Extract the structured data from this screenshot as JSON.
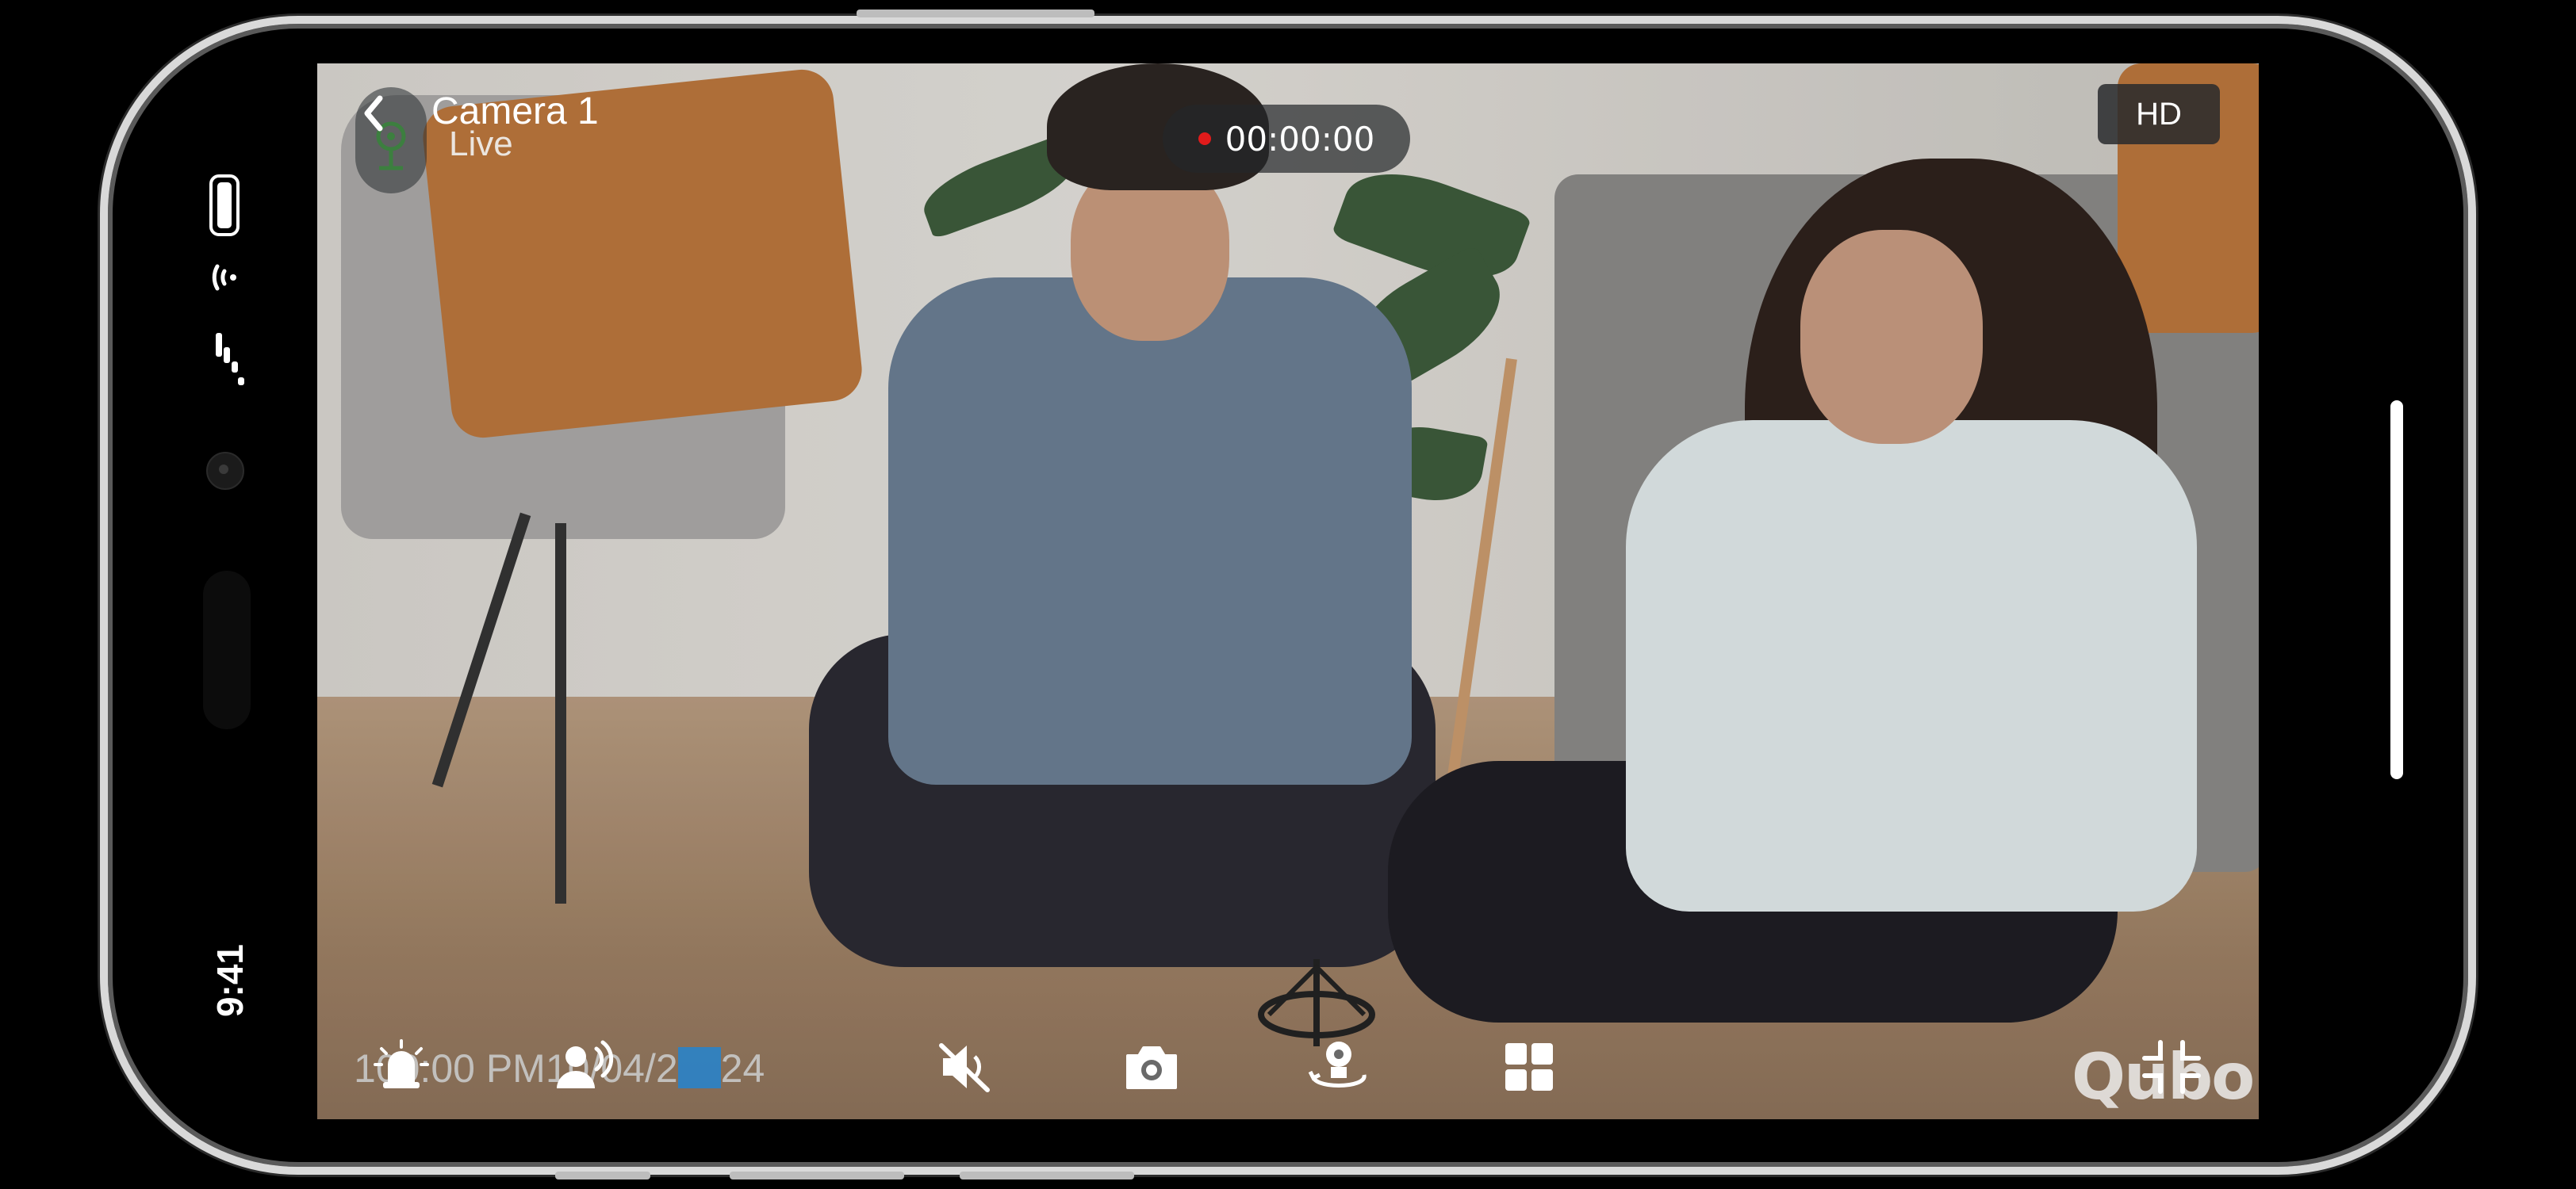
{
  "header": {
    "camera_name": "Camera 1",
    "stream_status": "Live",
    "recording_timer": "00:00:00",
    "quality_label": "HD"
  },
  "status_bar": {
    "time": "9:41"
  },
  "overlay": {
    "timestamp_prefix": "1",
    "timestamp_main": "00:00 PM10/04/2",
    "timestamp_suffix": "24",
    "brand_logo": "Qubo"
  },
  "controls": {
    "icons": [
      "alarm-bell-icon",
      "talk-icon",
      "mute-icon",
      "snapshot-camera-icon",
      "rotate-camera-icon",
      "grid-view-icon",
      "exit-fullscreen-icon"
    ]
  },
  "colors": {
    "recording_dot": "#e11b1b",
    "timestamp_square": "#2a83c9"
  }
}
